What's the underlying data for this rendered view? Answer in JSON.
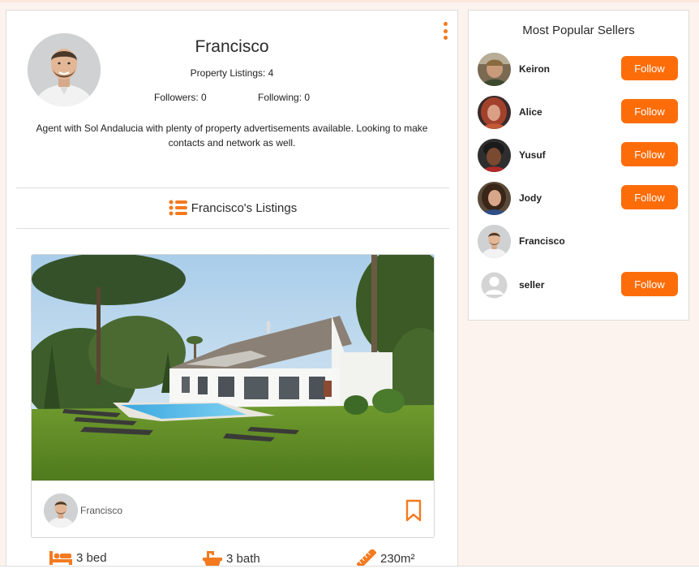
{
  "profile": {
    "name": "Francisco",
    "listings_label": "Property Listings: 4",
    "followers_label": "Followers: 0",
    "following_label": "Following: 0",
    "bio": "Agent with Sol Andalucia with plenty of property advertisements available. Looking to make contacts and network as well.",
    "listings_title": "Francisco's Listings"
  },
  "listing": {
    "agent_name": "Francisco",
    "beds": "3 bed",
    "baths": "3 bath",
    "area": "230m²"
  },
  "sellers": {
    "title": "Most Popular Sellers",
    "items": [
      {
        "name": "Keiron",
        "follow_label": "Follow"
      },
      {
        "name": "Alice",
        "follow_label": "Follow"
      },
      {
        "name": "Yusuf",
        "follow_label": "Follow"
      },
      {
        "name": "Jody",
        "follow_label": "Follow"
      },
      {
        "name": "Francisco"
      },
      {
        "name": "seller",
        "follow_label": "Follow"
      }
    ]
  },
  "colors": {
    "accent": "#fc6d0a",
    "icon": "#f47a1f",
    "background": "#fdf3ee"
  }
}
